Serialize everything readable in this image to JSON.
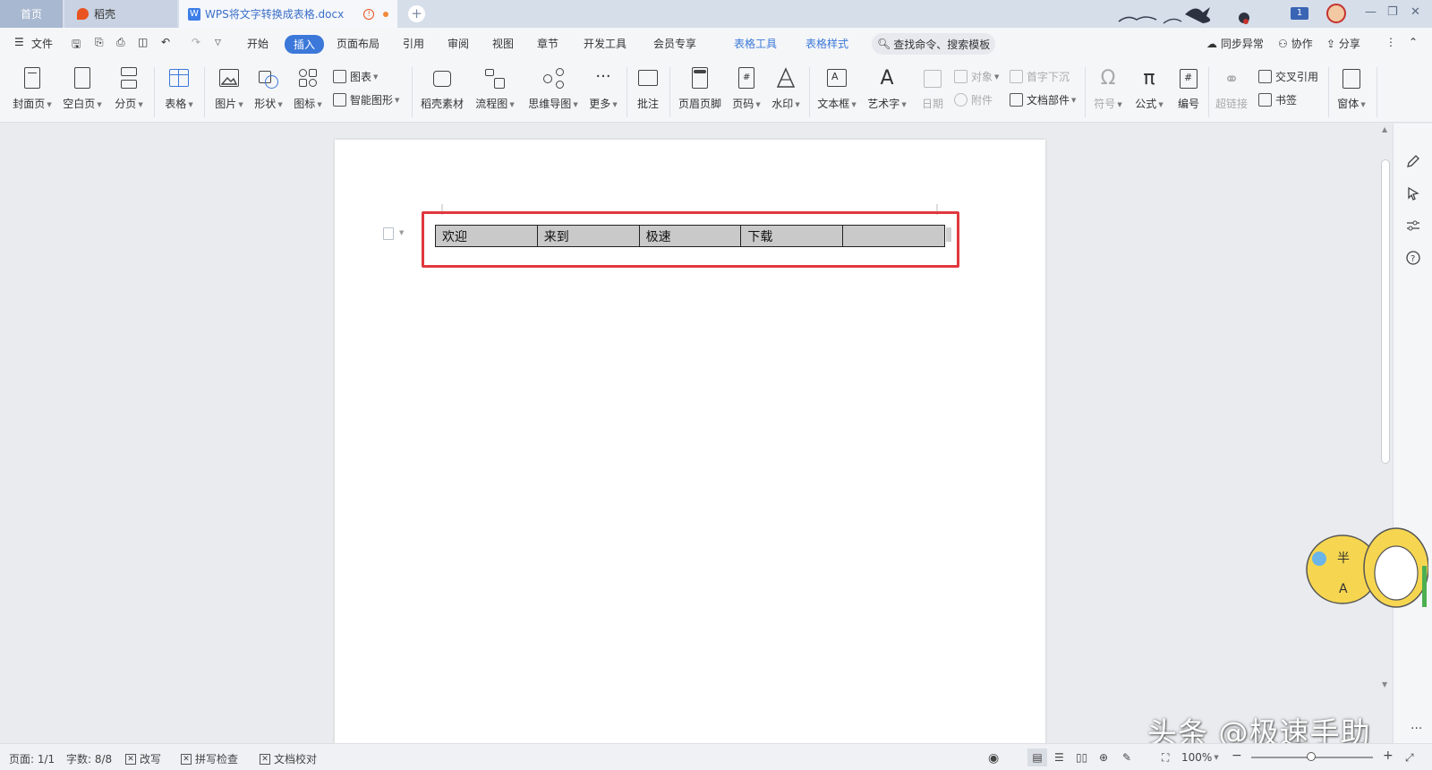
{
  "tabs": {
    "home": "首页",
    "daoke": "稻壳",
    "doc": "WPS将文字转换成表格.docx",
    "new_tab": "+"
  },
  "window": {
    "badge": "1"
  },
  "menu": {
    "file": "文件",
    "items": [
      "开始",
      "插入",
      "页面布局",
      "引用",
      "审阅",
      "视图",
      "章节",
      "开发工具",
      "会员专享"
    ],
    "active": "插入",
    "contextual": [
      "表格工具",
      "表格样式"
    ],
    "search": "查找命令、搜索模板",
    "sync": "同步异常",
    "collab": "协作",
    "share": "分享"
  },
  "ribbon": {
    "cover": "封面页",
    "blank": "空白页",
    "pagebreak": "分页",
    "table": "表格",
    "picture": "图片",
    "shape": "形状",
    "iconlib": "图标",
    "chart": "图表",
    "smartart": "智能图形",
    "daoke_material": "稻壳素材",
    "flowchart": "流程图",
    "mindmap": "思维导图",
    "more": "更多",
    "comment": "批注",
    "header_footer": "页眉页脚",
    "page_num": "页码",
    "watermark": "水印",
    "textbox": "文本框",
    "wordart": "艺术字",
    "date": "日期",
    "object": "对象",
    "attachment": "附件",
    "dropcap": "首字下沉",
    "docparts": "文档部件",
    "symbol": "符号",
    "formula": "公式",
    "numbering": "编号",
    "hyperlink": "超链接",
    "crossref": "交叉引用",
    "bookmark": "书签",
    "window": "窗体"
  },
  "document": {
    "table_cells": [
      "欢迎",
      "来到",
      "极速",
      "下载",
      ""
    ]
  },
  "watermark_text": "头条 @极速手助",
  "status": {
    "page": "页面: 1/1",
    "words": "字数: 8/8",
    "revise": "改写",
    "spellcheck": "拼写检查",
    "proofread": "文档校对",
    "zoom": "100%"
  },
  "colors": {
    "accent": "#3b78d9",
    "highlight": "#e0383e",
    "table_fill": "#c9c9c9"
  }
}
